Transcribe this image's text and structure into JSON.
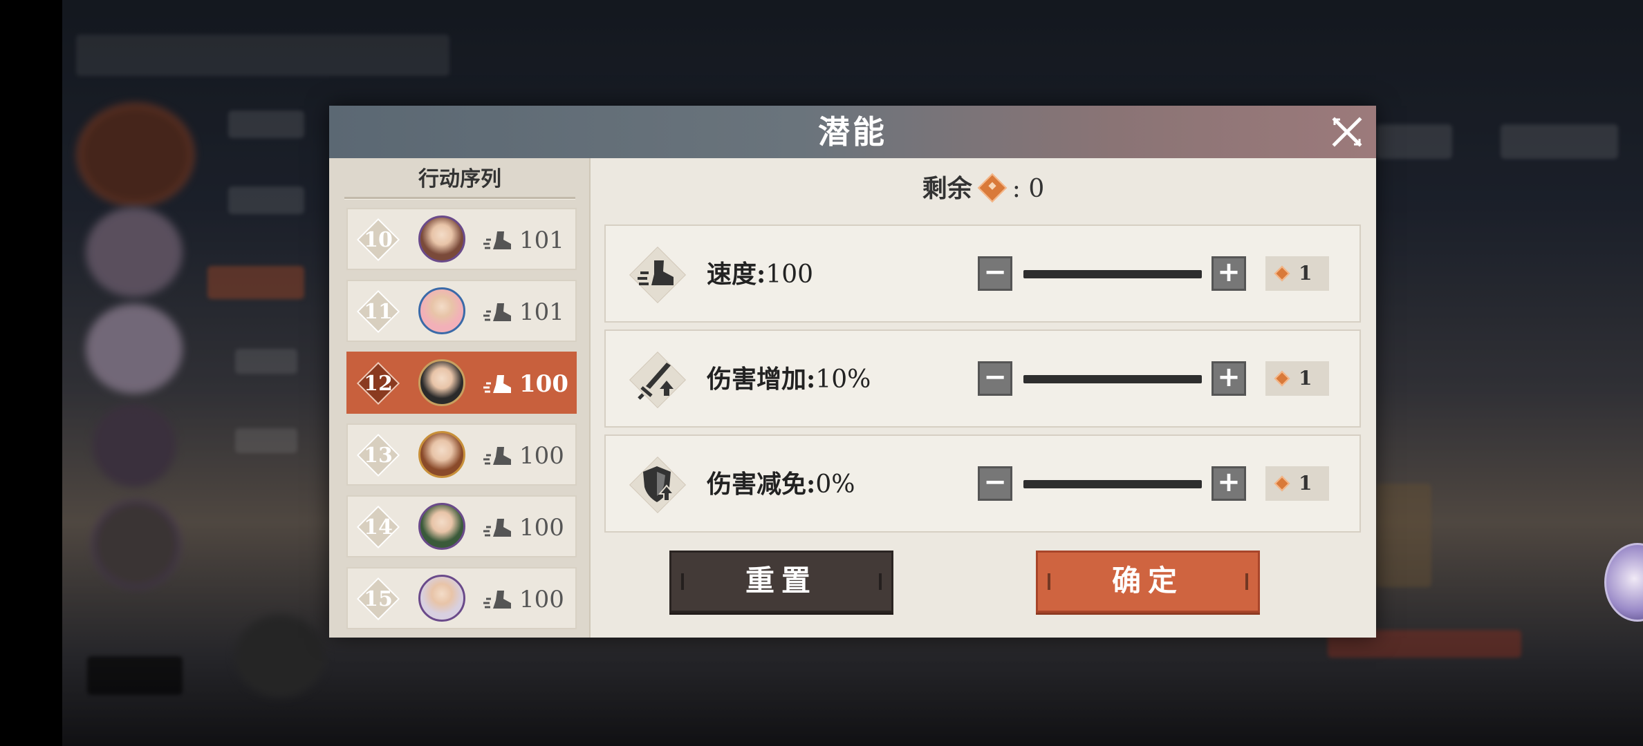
{
  "dialog": {
    "title": "潜能",
    "close_icon": "close-x-icon"
  },
  "action_list": {
    "header": "行动序列",
    "items": [
      {
        "rank": "10",
        "speed": "101",
        "active": false,
        "avatar": "character-avatar-dark-hair-purple-frame"
      },
      {
        "rank": "11",
        "speed": "101",
        "active": false,
        "avatar": "character-avatar-pink-hair-blue-frame"
      },
      {
        "rank": "12",
        "speed": "100",
        "active": true,
        "avatar": "character-avatar-officer-cap"
      },
      {
        "rank": "13",
        "speed": "100",
        "active": false,
        "avatar": "character-avatar-red-bandana"
      },
      {
        "rank": "14",
        "speed": "100",
        "active": false,
        "avatar": "character-avatar-green-hair"
      },
      {
        "rank": "15",
        "speed": "100",
        "active": false,
        "avatar": "character-avatar-silver-hair"
      }
    ]
  },
  "potential": {
    "remaining_label": "剩余",
    "remaining_sep": ": ",
    "remaining_value": "0",
    "stats": [
      {
        "label": "速度",
        "sep": ":",
        "value": "100",
        "cost": "1",
        "icon": "boot-speed-icon"
      },
      {
        "label": "伤害增加",
        "sep": ":",
        "value": "10%",
        "cost": "1",
        "icon": "sword-up-icon"
      },
      {
        "label": "伤害减免",
        "sep": ":",
        "value": "0%",
        "cost": "1",
        "icon": "shield-up-icon"
      }
    ],
    "minus_symbol": "−",
    "plus_symbol": "+"
  },
  "buttons": {
    "reset": "重置",
    "confirm": "确定"
  },
  "colors": {
    "accent": "#cf6440",
    "dark_button": "#433a37",
    "gem": "#d97a3a"
  }
}
